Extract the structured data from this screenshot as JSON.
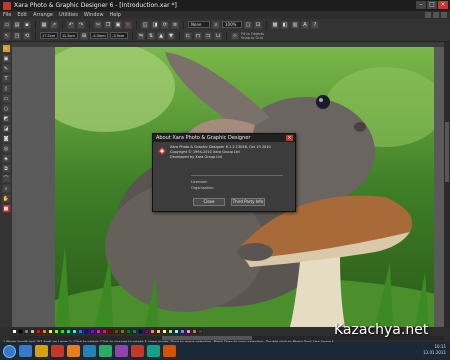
{
  "window": {
    "title": "Xara Photo & Graphic Designer 6 - [Introduction.xar *]"
  },
  "menu": [
    "File",
    "Edit",
    "Arrange",
    "Utilities",
    "Window",
    "Help"
  ],
  "toolbar": {
    "zoom_value": "100%",
    "zoom_mode": "None"
  },
  "infobar": {
    "x_value": "17.2cm",
    "y_value": "11.3cm",
    "w_value": "-4.0mm",
    "h_value": "-3.9cm",
    "snap_lines": [
      "Fit to Objects",
      "Snap to Grid"
    ]
  },
  "dialog": {
    "title": "About Xara Photo & Graphic Designer",
    "lines": [
      "Xara Photo & Graphic Designer 6.1.2.13048, Oct 19 2010",
      "Copyright © 1994-2010 Xara Group Ltd",
      "Developed by Xara Group Ltd"
    ],
    "licensee_label": "Licensee:",
    "organisation_label": "Organisation:",
    "ok_label": "Close",
    "more_label": "Third Party Info"
  },
  "status": {
    "text": "1 Photo 'krolik.jpg' (57.4pd) on Layer 1: Click to select; Click to change to rotate & skew mode; Drag to move selection; Right Drag to copy selection; Double click to Photo Tool; Use Arrow to Nudge"
  },
  "watermark": "Kazachya.net",
  "clock": {
    "time": "10:11",
    "date": "13.01.2011"
  },
  "palette_colors": [
    "#ffffff",
    "#000000",
    "#7f7f7f",
    "#c0c0c0",
    "#ff0000",
    "#ff8000",
    "#ffff00",
    "#80ff00",
    "#00ff00",
    "#00ff80",
    "#00ffff",
    "#0080ff",
    "#0000ff",
    "#8000ff",
    "#ff00ff",
    "#ff0080",
    "#800000",
    "#804000",
    "#808000",
    "#008000",
    "#008080",
    "#000080",
    "#800080",
    "#ff8080",
    "#ffc080",
    "#ffff80",
    "#80ff80",
    "#80ffff",
    "#8080ff",
    "#ff80ff",
    "#c08040",
    "#404040"
  ]
}
